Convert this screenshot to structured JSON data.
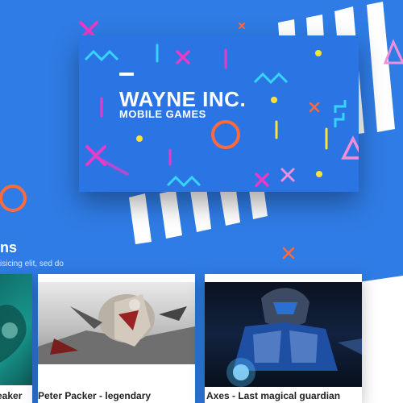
{
  "hero": {
    "title": "WAYNE INC.",
    "subtitle": "MOBILE GAMES"
  },
  "section": {
    "title_partial": "ns",
    "subtitle_partial": "isicing elit, sed do"
  },
  "cards": [
    {
      "caption": "eaker"
    },
    {
      "caption": "Peter Packer - legendary"
    },
    {
      "caption": "Axes - Last magical guardian"
    }
  ],
  "colors": {
    "background": "#2f7ce6",
    "hero": "#2a75e3",
    "magenta": "#e83bc9",
    "orange": "#ff6a3c",
    "yellow": "#ffe23a",
    "cyan": "#36d4ff",
    "pink": "#f38fd8"
  }
}
